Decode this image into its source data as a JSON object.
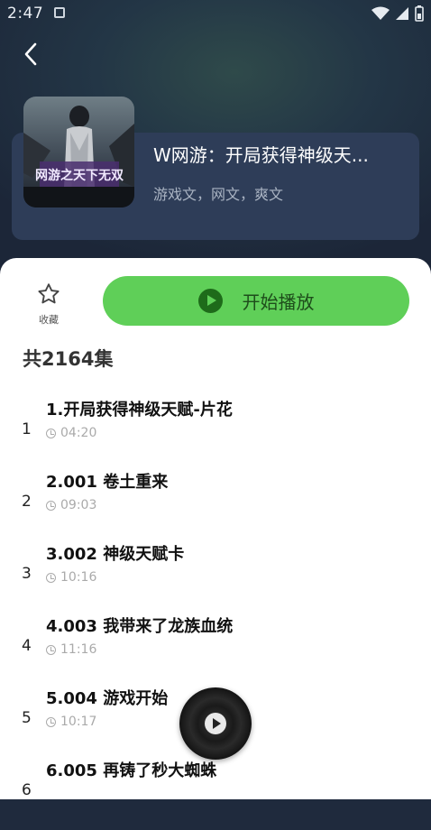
{
  "status": {
    "time": "2:47"
  },
  "book": {
    "title": "W网游：开局获得神级天...",
    "tags": "游戏文，网文，爽文",
    "cover_text": "网游之天下无双"
  },
  "actions": {
    "favorite_label": "收藏",
    "play_label": "开始播放"
  },
  "episodes_header": "共2164集",
  "episodes": [
    {
      "num": "1",
      "title": "1.开局获得神级天赋-片花",
      "duration": "04:20"
    },
    {
      "num": "2",
      "title": "2.001 卷土重来",
      "duration": "09:03"
    },
    {
      "num": "3",
      "title": "3.002 神级天赋卡",
      "duration": "10:16"
    },
    {
      "num": "4",
      "title": "4.003 我带来了龙族血统",
      "duration": "11:16"
    },
    {
      "num": "5",
      "title": "5.004 游戏开始",
      "duration": "10:17"
    },
    {
      "num": "6",
      "title": "6.005 再铸了秒大蜘蛛",
      "duration": ""
    }
  ],
  "colors": {
    "accent": "#5fcf58",
    "header_bg": "#1f2a3d",
    "card_bg": "#2e3d58"
  }
}
